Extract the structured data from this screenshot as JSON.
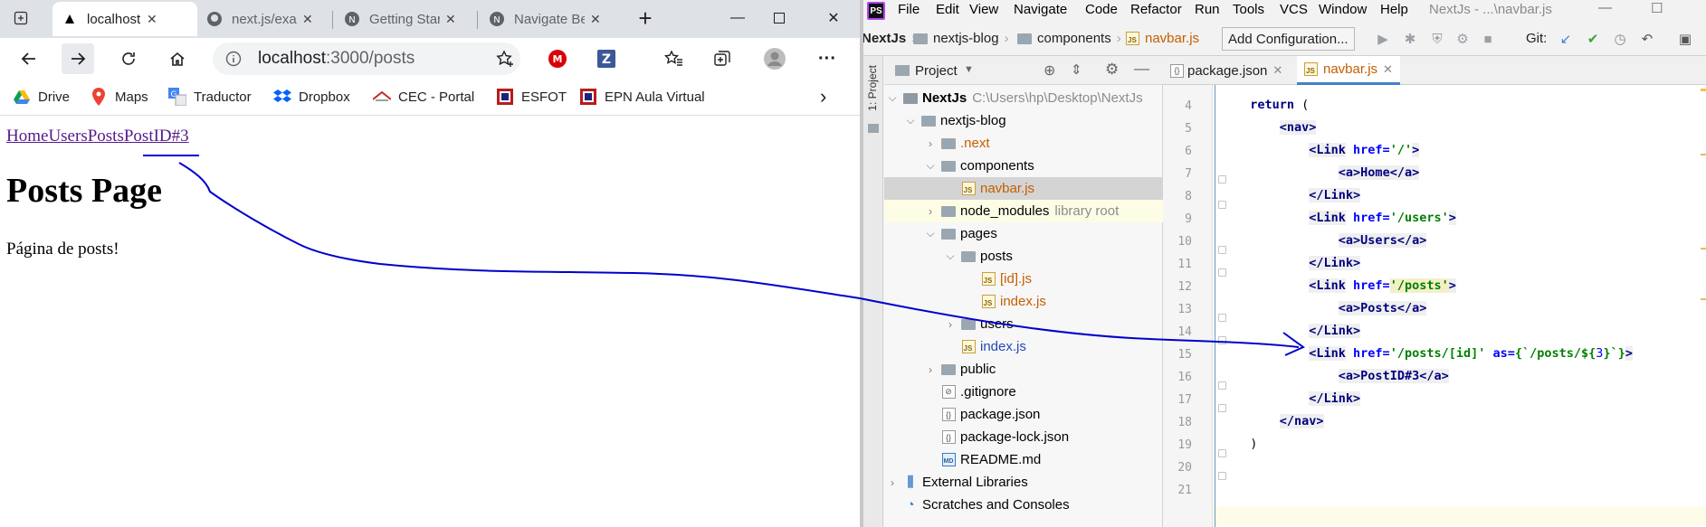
{
  "browser": {
    "tabs": [
      {
        "label": "localhost:3000/posts",
        "icon": "triangle-icon",
        "active": true
      },
      {
        "label": "next.js/examples",
        "icon": "github-icon"
      },
      {
        "label": "Getting Started",
        "icon": "nextjs-icon"
      },
      {
        "label": "Navigate Between Pages",
        "icon": "nextjs-icon"
      }
    ],
    "new_tab": "+",
    "url_host": "localhost",
    "url_path": ":3000/posts",
    "bookmarks": [
      {
        "label": "Drive",
        "icon": "drive-icon"
      },
      {
        "label": "Maps",
        "icon": "maps-icon"
      },
      {
        "label": "Traductor",
        "icon": "translate-icon"
      },
      {
        "label": "Dropbox",
        "icon": "dropbox-icon"
      },
      {
        "label": "CEC - Portal",
        "icon": "cec-icon"
      },
      {
        "label": "ESFOT",
        "icon": "esfot-icon"
      },
      {
        "label": "EPN Aula Virtual",
        "icon": "epn-icon"
      }
    ],
    "page": {
      "nav_links": [
        "Home",
        "Users",
        "Posts",
        "PostID#3"
      ],
      "heading": "Posts Page",
      "paragraph": "Página de posts!"
    }
  },
  "ide": {
    "menu": [
      "File",
      "Edit",
      "View",
      "Navigate",
      "Code",
      "Refactor",
      "Run",
      "Tools",
      "VCS",
      "Window",
      "Help"
    ],
    "title": "NextJs - ...\\navbar.js",
    "breadcrumbs": [
      "NextJs",
      "nextjs-blog",
      "components",
      "navbar.js"
    ],
    "add_configuration": "Add Configuration...",
    "git_label": "Git:",
    "side_strip_label": "1: Project",
    "project_panel_title": "Project",
    "tree": [
      {
        "label": "NextJs",
        "hint": "C:\\Users\\hp\\Desktop\\NextJs",
        "type": "folder"
      },
      {
        "label": "nextjs-blog",
        "type": "folder"
      },
      {
        "label": ".next",
        "type": "folder"
      },
      {
        "label": "components",
        "type": "folder"
      },
      {
        "label": "navbar.js",
        "type": "js"
      },
      {
        "label": "node_modules",
        "hint": "library root",
        "type": "folder"
      },
      {
        "label": "pages",
        "type": "folder"
      },
      {
        "label": "posts",
        "type": "folder"
      },
      {
        "label": "[id].js",
        "type": "js"
      },
      {
        "label": "index.js",
        "type": "js"
      },
      {
        "label": "users",
        "type": "folder"
      },
      {
        "label": "index.js",
        "type": "js"
      },
      {
        "label": "public",
        "type": "folder"
      },
      {
        "label": ".gitignore",
        "type": "file"
      },
      {
        "label": "package.json",
        "type": "json"
      },
      {
        "label": "package-lock.json",
        "type": "json"
      },
      {
        "label": "README.md",
        "type": "md"
      },
      {
        "label": "External Libraries",
        "type": "lib"
      },
      {
        "label": "Scratches and Consoles",
        "type": "scratch"
      }
    ],
    "editor_tabs": [
      {
        "label": "package.json",
        "active": false
      },
      {
        "label": "navbar.js",
        "active": true
      }
    ],
    "line_numbers": [
      "4",
      "5",
      "6",
      "7",
      "8",
      "9",
      "10",
      "11",
      "12",
      "13",
      "14",
      "15",
      "16",
      "17",
      "18",
      "19",
      "20",
      "21"
    ],
    "code": {
      "l4_kw": "return",
      "l4_rest": " (",
      "l5": "<nav>",
      "l6_tag": "<Link",
      "l6_attr": " href=",
      "l6_str": "'/'",
      "l6_end": ">",
      "l7": "<a>Home</a>",
      "l8": "</Link>",
      "l9_tag": "<Link",
      "l9_attr": " href=",
      "l9_str": "'/users'",
      "l9_end": ">",
      "l10": "<a>Users</a>",
      "l11": "</Link>",
      "l12_tag": "<Link",
      "l12_attr": " href=",
      "l12_str": "'/posts'",
      "l12_end": ">",
      "l13": "<a>Posts</a>",
      "l14": "</Link>",
      "l15_tag": "<Link",
      "l15_attr": " href=",
      "l15_str": "'/posts/[id]'",
      "l15_attr2": " as=",
      "l15_tmpl": "{`/posts/${",
      "l15_num": "3",
      "l15_tmpl2": "}`}",
      "l15_end": ">",
      "l16": "<a>PostID#3</a>",
      "l17": "</Link>",
      "l18": "</nav>",
      "l19": ")"
    }
  },
  "annotation_color": "#0000cc"
}
